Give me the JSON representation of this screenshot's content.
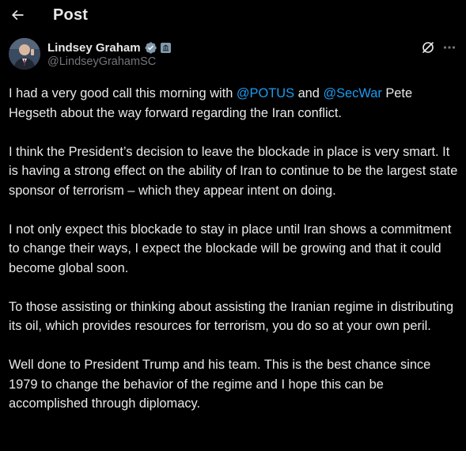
{
  "header": {
    "back_icon": "arrow-left-icon",
    "title": "Post"
  },
  "author": {
    "display_name": "Lindsey Graham",
    "handle": "@LindseyGrahamSC",
    "verified_icon": "verified-badge-icon",
    "affiliation_icon": "government-badge-icon",
    "avatar": "avatar"
  },
  "actions": {
    "grok_icon": "grok-icon",
    "more_icon": "more-options-icon"
  },
  "post": {
    "p1_a": "I had a very good call this morning with ",
    "p1_mention1": "@POTUS",
    "p1_b": " and ",
    "p1_mention2": "@SecWar",
    "p1_c": " Pete Hegseth about the way forward regarding the Iran conflict.",
    "p2": "I think the President’s decision to leave the blockade in place is very smart. It is having a strong effect on the ability of Iran to continue to be the largest state sponsor of terrorism – which they appear intent on doing.",
    "p3": "I not only expect this blockade to stay in place until Iran shows a commitment to change their ways, I expect the blockade will be growing and that it could become global soon.",
    "p4": "To those assisting or thinking about assisting the Iranian regime in distributing its oil, which provides resources for terrorism, you do so at your own peril.",
    "p5": "Well done to President Trump and his team. This is the best chance since 1979 to change the behavior of the regime and I hope this can be accomplished through diplomacy."
  },
  "colors": {
    "background": "#000000",
    "text": "#e7e9ea",
    "secondary": "#71767b",
    "link": "#1d9bf0",
    "gov_badge": "#829aab"
  }
}
